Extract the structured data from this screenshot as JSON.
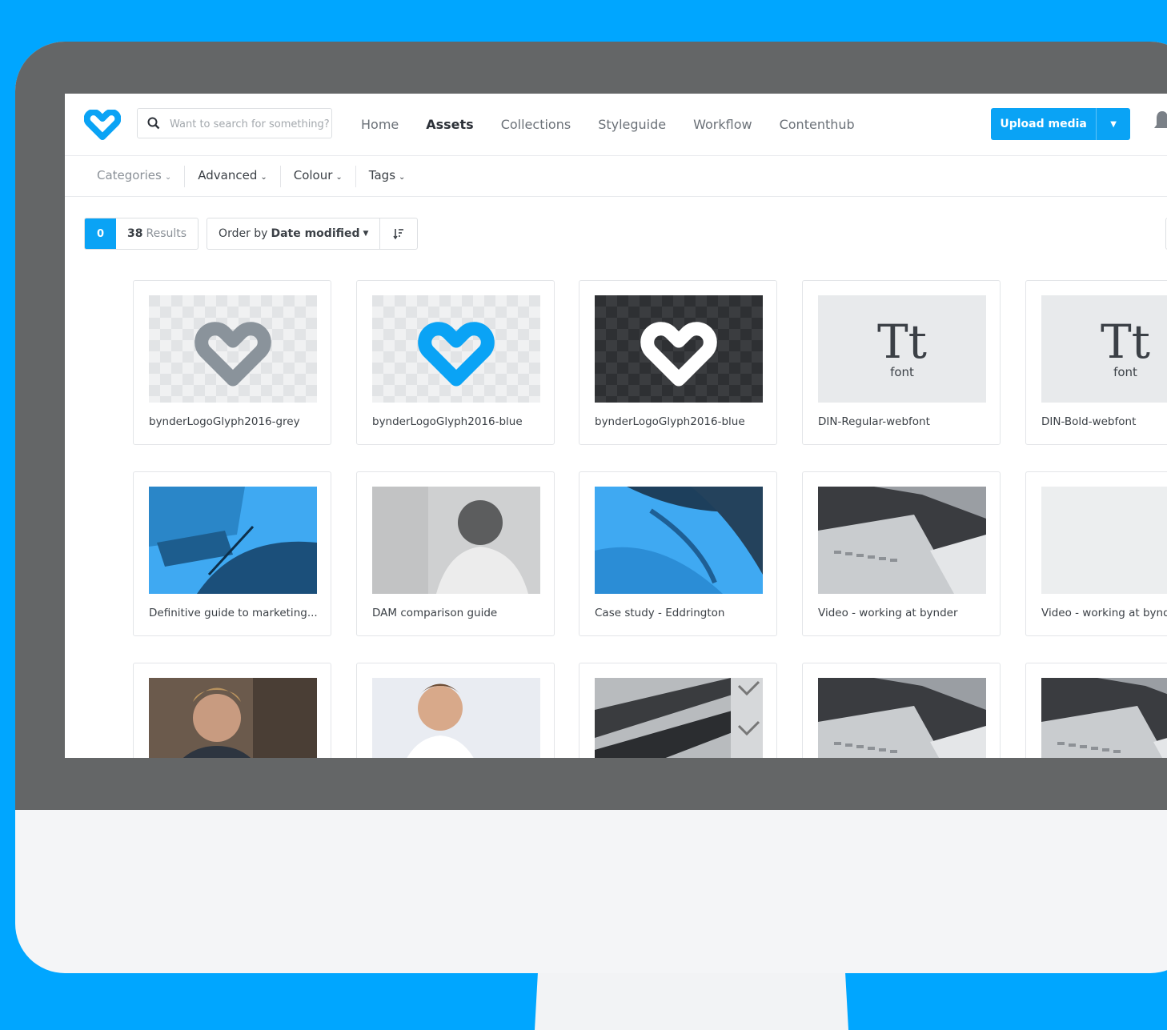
{
  "search": {
    "placeholder": "Want to search for something?"
  },
  "nav": {
    "items": [
      "Home",
      "Assets",
      "Collections",
      "Styleguide",
      "Workflow",
      "Contenthub"
    ],
    "active": "Assets"
  },
  "upload": {
    "label": "Upload media"
  },
  "filters": [
    "Categories",
    "Advanced",
    "Colour",
    "Tags"
  ],
  "results": {
    "selected": "0",
    "count": "38",
    "count_label": "Results"
  },
  "order": {
    "prefix": "Order by",
    "value": "Date modified"
  },
  "font_thumb": {
    "glyph": "Tt",
    "label": "font"
  },
  "assets": [
    {
      "title": "bynderLogoGlyph2016-grey",
      "kind": "logo-grey"
    },
    {
      "title": "bynderLogoGlyph2016-blue",
      "kind": "logo-blue"
    },
    {
      "title": "bynderLogoGlyph2016-blue",
      "kind": "logo-white-dark"
    },
    {
      "title": "DIN-Regular-webfont",
      "kind": "font"
    },
    {
      "title": "DIN-Bold-webfont",
      "kind": "font"
    },
    {
      "title": "Definitive guide to marketing...",
      "kind": "photo-blue"
    },
    {
      "title": "DAM comparison guide",
      "kind": "photo-grey"
    },
    {
      "title": "Case study - Eddrington",
      "kind": "photo-blue-abstract"
    },
    {
      "title": "Video - working at bynder",
      "kind": "photo-tablet"
    },
    {
      "title": "Video - working at bynder",
      "kind": "blank"
    },
    {
      "title": "",
      "kind": "photo-person"
    },
    {
      "title": "",
      "kind": "photo-person-light"
    },
    {
      "title": "",
      "kind": "photo-architecture"
    },
    {
      "title": "",
      "kind": "photo-tablet"
    },
    {
      "title": "",
      "kind": "photo-tablet"
    }
  ],
  "colors": {
    "accent": "#0aa3f5",
    "background": "#00a6ff",
    "bezel": "#646667"
  }
}
